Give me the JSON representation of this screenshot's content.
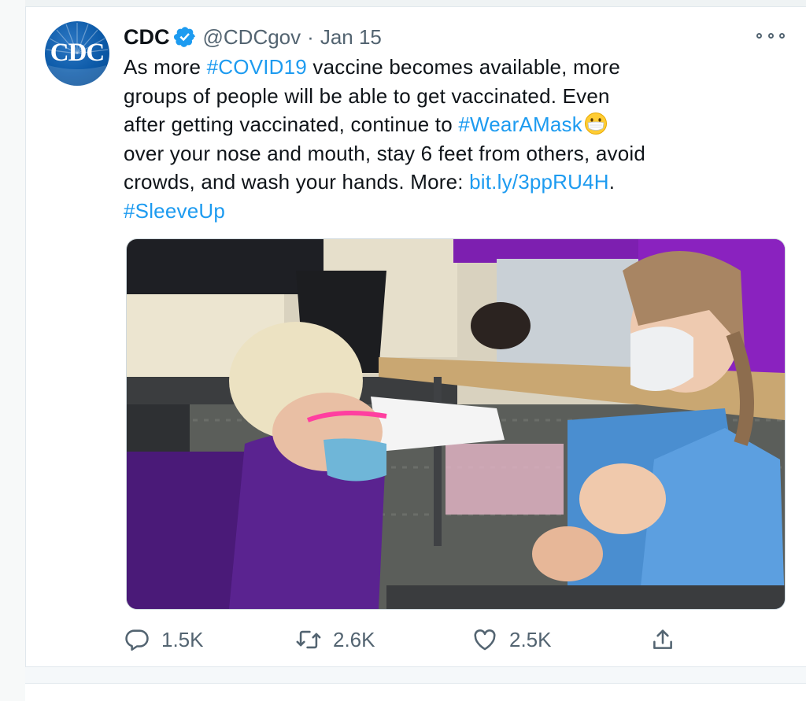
{
  "tweet": {
    "author_name": "CDC",
    "avatar_text": "CDC",
    "handle": "@CDCgov",
    "separator": "·",
    "date": "Jan 15",
    "text": {
      "l1_a": "As more ",
      "l1_hashtag": "#COVID19",
      "l1_b": " vaccine becomes available, more",
      "l2": "groups of people will be able to get vaccinated. Even",
      "l3_a": "after getting vaccinated, continue to ",
      "l3_hashtag": "#WearAMask",
      "l4": "over your nose and mouth, stay 6 feet from others, avoid",
      "l5_a": "crowds, and wash your hands. More:  ",
      "l5_link": "bit.ly/3ppRU4H",
      "l5_b": ".",
      "l6_hashtag": "#SleeveUp"
    },
    "emoji": "mask-emoji",
    "actions": {
      "replies": "1.5K",
      "retweets": "2.6K",
      "likes": "2.5K"
    }
  },
  "icons": {
    "verified": "verified-badge-icon",
    "more": "more-icon",
    "reply": "reply-icon",
    "retweet": "retweet-icon",
    "like": "heart-icon",
    "share": "share-icon"
  },
  "colors": {
    "link": "#1d9bf0",
    "secondary_text": "#536471",
    "avatar_blue": "#0c5aa8"
  }
}
